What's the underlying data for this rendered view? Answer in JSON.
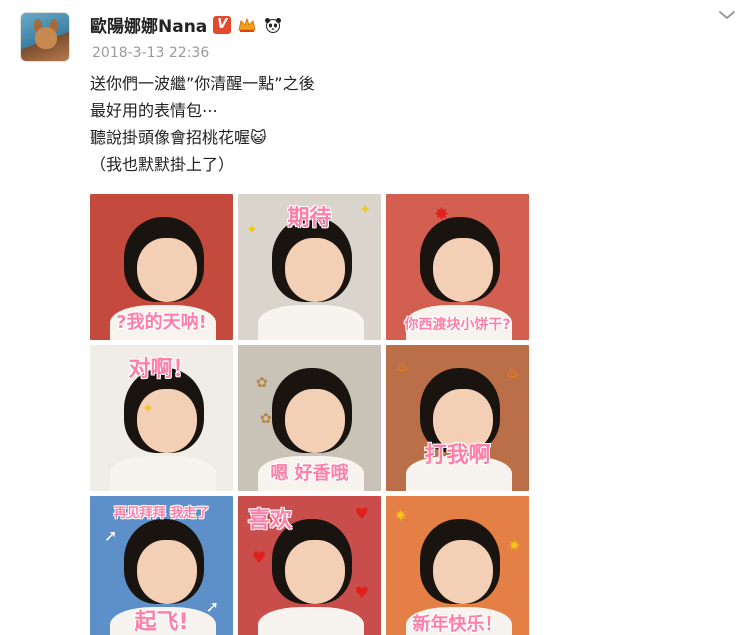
{
  "post": {
    "author": "歐陽娜娜Nana",
    "verified_badge": "V",
    "timestamp": "2018-3-13 22:36",
    "text_lines": [
      "送你們一波繼”你清醒一點”之後",
      "最好用的表情包⋯",
      "聽說掛頭像會招桃花喔😺",
      "（我也默默掛上了）"
    ]
  },
  "stickers": [
    {
      "caption": "?我的天呐!",
      "bg": "#c44a3e"
    },
    {
      "caption": "期待",
      "bg": "#d9d4cc"
    },
    {
      "caption": "你西渡块小饼干?",
      "bg": "#d25f4f"
    },
    {
      "caption": "对啊！",
      "bg": "#f0ede8"
    },
    {
      "caption": "嗯 好香哦",
      "bg": "#c9c2b6"
    },
    {
      "caption": "打我啊",
      "bg": "#bb6f49"
    },
    {
      "caption": "再见拜拜 我走了",
      "caption2": "起飞!",
      "bg": "#5d8fc9"
    },
    {
      "caption": "喜欢",
      "bg": "#c94d4a"
    },
    {
      "caption": "新年快乐！",
      "bg": "#e47f46"
    }
  ],
  "icons": {
    "expand": "chevron-down-icon",
    "crown": "crown-icon",
    "panda": "panda-icon"
  },
  "colors": {
    "text": "#222222",
    "timestamp": "#9a9a9a",
    "verified": "#e3492b",
    "caption": "#ff7fa8"
  }
}
